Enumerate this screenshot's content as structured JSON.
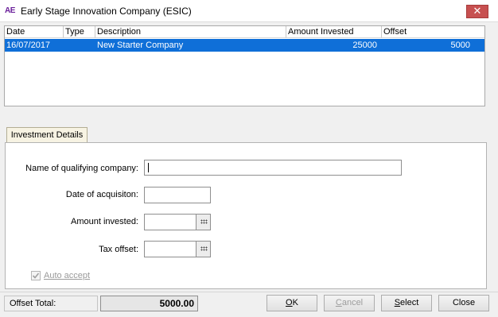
{
  "window": {
    "logo": "AE",
    "title": "Early Stage Innovation Company (ESIC)",
    "close_glyph": "✕"
  },
  "table": {
    "columns": [
      "Date",
      "Type",
      "Description",
      "Amount Invested",
      "Offset"
    ],
    "rows": [
      {
        "date": "16/07/2017",
        "type": "",
        "description": "New Starter Company",
        "amount": "25000",
        "offset": "5000",
        "selected": true
      }
    ]
  },
  "tab": {
    "label": "Investment Details"
  },
  "form": {
    "company_label": "Name of qualifying company:",
    "company_value": "",
    "date_label": "Date of acquisiton:",
    "date_value": "",
    "amount_label": "Amount invested:",
    "amount_value": "",
    "tax_label": "Tax offset:",
    "tax_value": "",
    "auto_accept_label": "Auto accept",
    "auto_accept_checked": true
  },
  "footer": {
    "offset_total_label": "Offset Total:",
    "offset_total_value": "5000.00",
    "ok": {
      "mnemonic": "O",
      "rest": "K"
    },
    "cancel": {
      "mnemonic": "C",
      "rest": "ancel"
    },
    "select": {
      "mnemonic": "S",
      "rest": "elect"
    },
    "close_label": "Close"
  },
  "colors": {
    "selection": "#0f6fd8",
    "close_button": "#c75050",
    "logo": "#6a1f9a"
  }
}
